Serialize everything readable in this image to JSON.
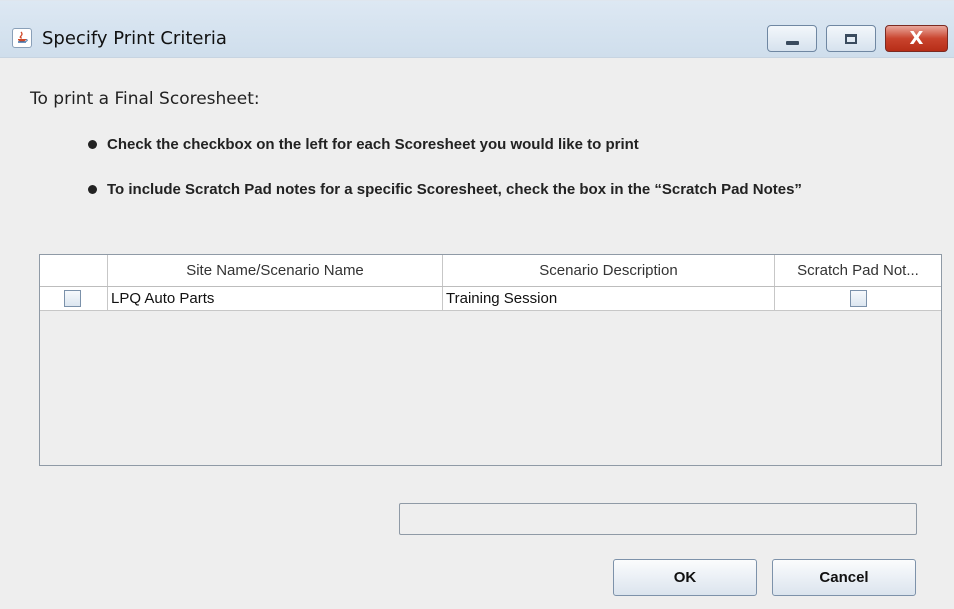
{
  "window": {
    "title": "Specify Print Criteria",
    "icon": "java-coffee-icon",
    "controls": {
      "minimize": "minimize-icon",
      "maximize": "maximize-icon",
      "close": "X"
    }
  },
  "instructions": {
    "heading": "To print a Final Scoresheet:",
    "bullets": [
      "Check the checkbox on the left for each Scoresheet you would like to print",
      "To include Scratch Pad notes for a specific Scoresheet, check the box in the “Scratch Pad Notes”"
    ]
  },
  "table": {
    "columns": [
      "",
      "Site Name/Scenario Name",
      "Scenario Description",
      "Scratch Pad Not..."
    ],
    "rows": [
      {
        "selected": false,
        "site_name": "LPQ Auto Parts",
        "description": "Training Session",
        "scratch_pad": false
      }
    ]
  },
  "status_field": {
    "value": ""
  },
  "buttons": {
    "ok": "OK",
    "cancel": "Cancel"
  }
}
